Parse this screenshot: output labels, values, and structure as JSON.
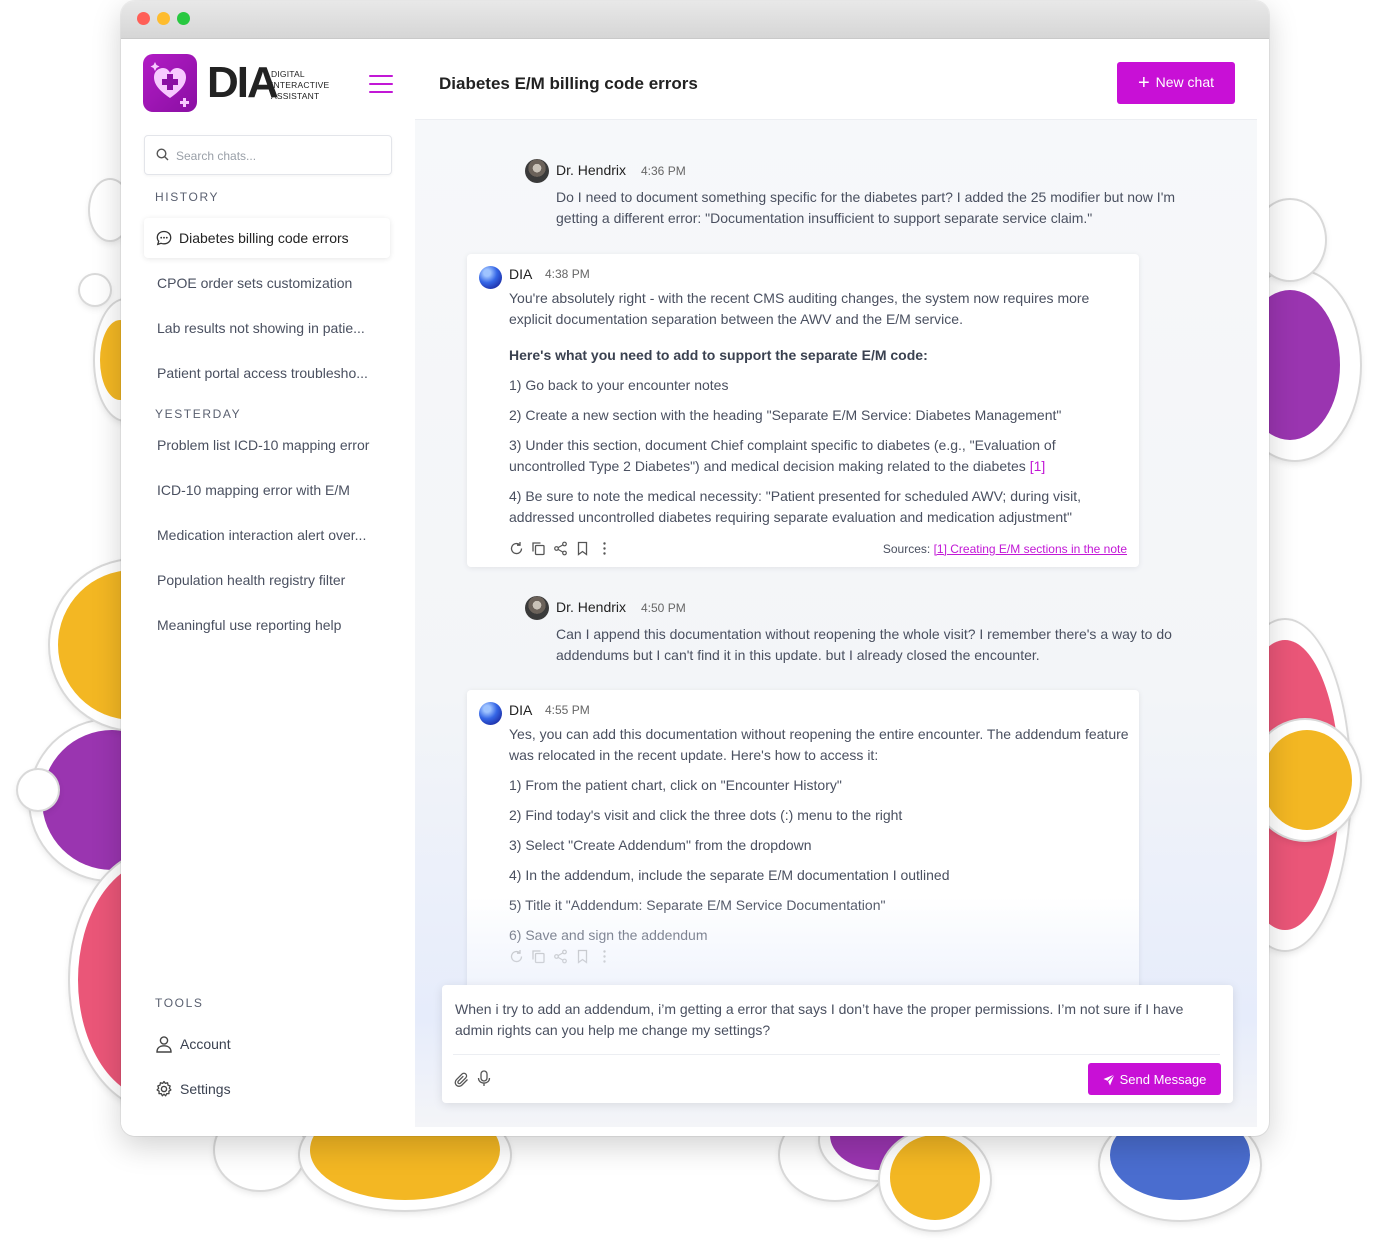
{
  "colors": {
    "accent": "#c810d6",
    "logo": "#a315b8"
  },
  "sidebar": {
    "logo": {
      "mark": "DIA",
      "sub_line1": "DIGITAL",
      "sub_line2": "INTERACTIVE",
      "sub_line3": "ASSISTANT"
    },
    "search_placeholder": "Search chats...",
    "history_label": "HISTORY",
    "history": [
      "Diabetes billing code errors",
      "CPOE order sets customization",
      "Lab results not showing in patie...",
      "Patient portal access troublesho..."
    ],
    "yesterday_label": "YESTERDAY",
    "yesterday": [
      "Problem list ICD-10 mapping error",
      "ICD-10 mapping error with E/M",
      "Medication interaction alert over...",
      "Population health registry filter",
      "Meaningful use reporting help"
    ],
    "tools_label": "TOOLS",
    "tools": [
      "Account",
      "Settings"
    ]
  },
  "header": {
    "title": "Diabetes E/M billing code errors",
    "new_chat": "New chat"
  },
  "messages": {
    "m1": {
      "name": "Dr. Hendrix",
      "time": "4:36 PM",
      "text": "Do I need to document something specific for the diabetes part? I added the 25 modifier but now I'm getting a different error: \"Documentation insufficient to support separate service claim.\""
    },
    "m2": {
      "name": "DIA",
      "time": "4:38 PM",
      "p1": "You're absolutely right - with the recent CMS auditing changes, the system now requires more explicit documentation separation between the AWV and the E/M service.",
      "heading": "Here's what you need to add to support the separate E/M code:",
      "s1": "1) Go back to your encounter notes",
      "s2": "2) Create a new section with the heading \"Separate E/M Service: Diabetes Management\"",
      "s3": "3) Under this section, document Chief complaint specific to diabetes (e.g., \"Evaluation of uncontrolled Type 2 Diabetes\") and medical decision making related to the diabetes",
      "s3_cite": "[1]",
      "s4": "4) Be sure to note the medical necessity: \"Patient presented for scheduled AWV; during visit, addressed uncontrolled diabetes requiring separate evaluation and medication adjustment\"",
      "sources_label": "Sources:",
      "source_link": "[1] Creating E/M sections in the note"
    },
    "m3": {
      "name": "Dr. Hendrix",
      "time": "4:50 PM",
      "text": "Can I append this documentation without reopening the whole visit? I remember there's a way to do addendums but I can't find it in this update. but I already closed the encounter."
    },
    "m4": {
      "name": "DIA",
      "time": "4:55 PM",
      "p1": "Yes, you can add this documentation without reopening the entire encounter. The addendum feature was relocated in the recent update. Here's how to access it:",
      "s1": "1) From the patient chart, click on \"Encounter History\"",
      "s2": "2) Find today's visit and click the three dots (:) menu to the right",
      "s3": "3) Select \"Create Addendum\" from the dropdown",
      "s4": "4) In the addendum, include the separate E/M documentation I outlined",
      "s5": "5) Title it \"Addendum: Separate E/M Service Documentation\"",
      "s6": "6) Save and sign the addendum"
    }
  },
  "composer": {
    "value": "When i try to add an addendum, i’m getting a error that says I don’t have the proper permissions. I’m not sure if I have admin rights can you help me change my settings?",
    "send_label": "Send Message"
  }
}
